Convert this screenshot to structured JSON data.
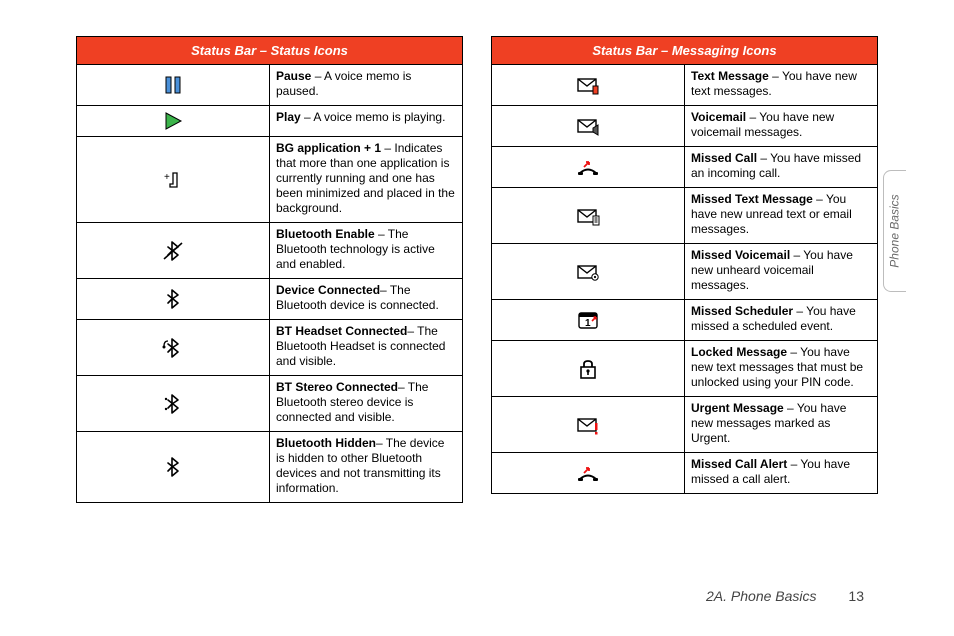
{
  "sideTab": "Phone Basics",
  "footer": {
    "section": "2A. Phone Basics",
    "page": "13"
  },
  "tables": [
    {
      "header": "Status Bar – Status Icons",
      "rows": [
        {
          "icon": "pause",
          "term": "Pause",
          "desc": " – A voice memo is paused."
        },
        {
          "icon": "play",
          "term": "Play",
          "desc": " – A voice memo is playing."
        },
        {
          "icon": "plus1",
          "term": "BG application + 1",
          "desc": " – Indicates that more than one application is currently running and one has been minimized and placed in the background."
        },
        {
          "icon": "bt-enable",
          "term": "Bluetooth Enable",
          "desc": " – The Bluetooth technology is active and enabled."
        },
        {
          "icon": "bt-conn",
          "term": "Device Connected",
          "desc": "– The Bluetooth device is connected."
        },
        {
          "icon": "bt-headset",
          "term": "BT Headset Connected",
          "desc": "– The Bluetooth Headset is connected and visible."
        },
        {
          "icon": "bt-stereo",
          "term": "BT Stereo Connected",
          "desc": "– The Bluetooth stereo device is connected and visible."
        },
        {
          "icon": "bt-hidden",
          "term": "Bluetooth Hidden",
          "desc": "– The device is hidden to other Bluetooth devices and not transmitting its information."
        }
      ]
    },
    {
      "header": "Status Bar – Messaging Icons",
      "rows": [
        {
          "icon": "text-msg",
          "term": "Text Message",
          "desc": " – You have new text messages."
        },
        {
          "icon": "voicemail",
          "term": "Voicemail",
          "desc": " – You have new voicemail messages."
        },
        {
          "icon": "missed-call",
          "term": "Missed Call",
          "desc": " – You have missed an incoming call."
        },
        {
          "icon": "missed-text",
          "term": "Missed Text Message",
          "desc": " – You have new unread text or email messages."
        },
        {
          "icon": "missed-vm",
          "term": "Missed Voicemail",
          "desc": " – You have new unheard voicemail messages."
        },
        {
          "icon": "missed-sched",
          "term": "Missed Scheduler",
          "desc": " – You have missed a scheduled event."
        },
        {
          "icon": "locked-msg",
          "term": "Locked Message",
          "desc": " – You have new text messages that must be unlocked using your PIN code."
        },
        {
          "icon": "urgent-msg",
          "term": "Urgent Message",
          "desc": " – You have new messages marked as Urgent."
        },
        {
          "icon": "missed-alert",
          "term": "Missed Call Alert",
          "desc": " – You have missed a call alert."
        }
      ]
    }
  ]
}
